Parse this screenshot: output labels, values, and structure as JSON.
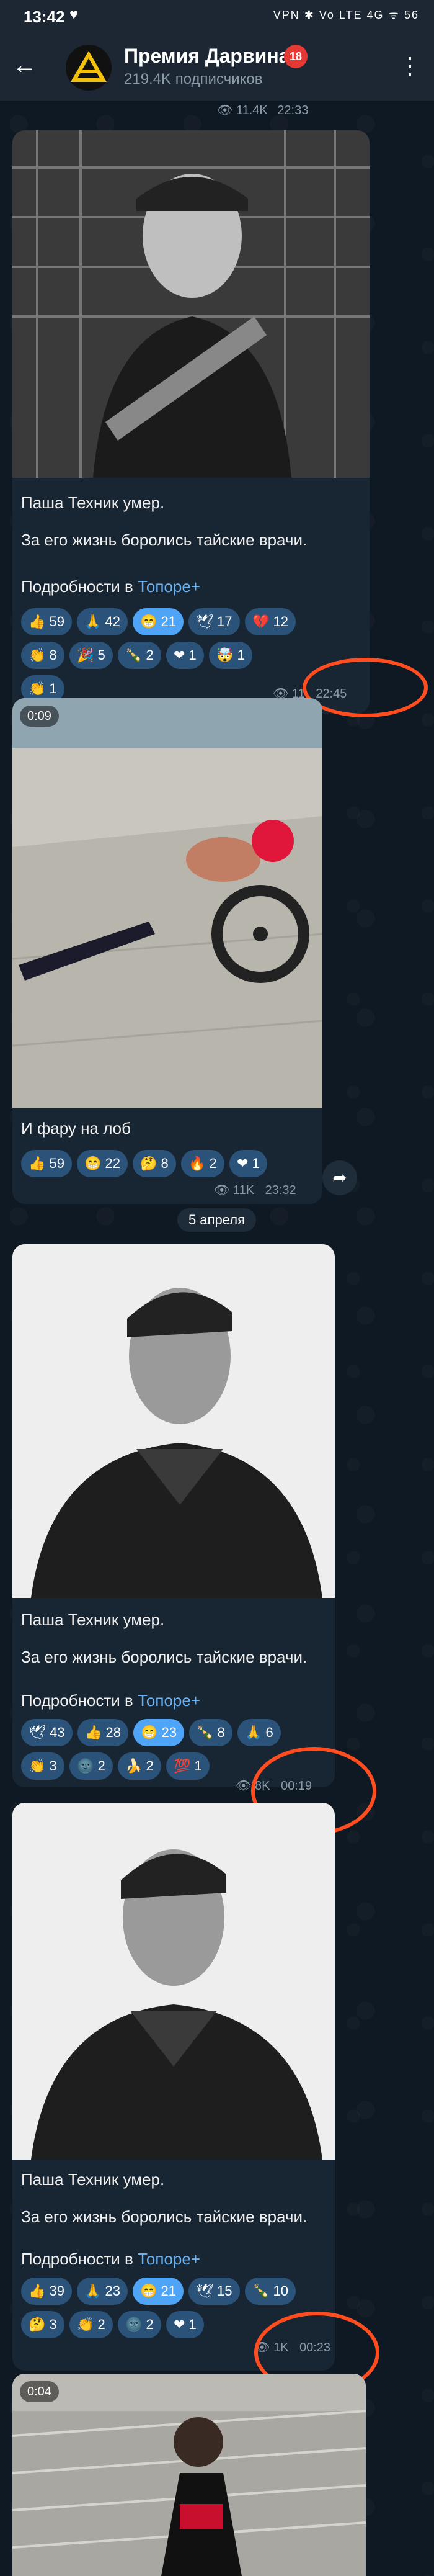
{
  "status_bar": {
    "time": "13:42",
    "indicators": "VPN ✱ Vo LTE 4G ᯤ 56"
  },
  "header": {
    "title": "Премия Дарвина",
    "age_badge": "18",
    "subscribers": "219.4K подписчиков"
  },
  "messages": [
    {
      "id": "msg-top",
      "views": "11.4K",
      "time": "22:33"
    },
    {
      "id": "msg-1",
      "text_line1": "Паша Техник умер.",
      "text_line2": "За его жизнь боролись тайские врачи.",
      "details_prefix": "Подробности в ",
      "details_link": "Топоре+",
      "reactions": [
        {
          "emoji": "👍",
          "count": "59"
        },
        {
          "emoji": "🙏",
          "count": "42"
        },
        {
          "emoji": "😁",
          "count": "21",
          "mine": true
        },
        {
          "emoji": "🕊",
          "count": "17"
        },
        {
          "emoji": "💔",
          "count": "12"
        },
        {
          "emoji": "👏",
          "count": "8"
        },
        {
          "emoji": "🎉",
          "count": "5"
        },
        {
          "emoji": "🍾",
          "count": "2"
        },
        {
          "emoji": "❤",
          "count": "1"
        },
        {
          "emoji": "🤯",
          "count": "1"
        },
        {
          "emoji": "👏",
          "count": "1"
        }
      ],
      "views": "11",
      "time": "22:45"
    },
    {
      "id": "msg-2",
      "duration": "0:09",
      "text": "И фару на лоб",
      "reactions": [
        {
          "emoji": "👍",
          "count": "59"
        },
        {
          "emoji": "😁",
          "count": "22"
        },
        {
          "emoji": "🤔",
          "count": "8"
        },
        {
          "emoji": "🔥",
          "count": "2"
        },
        {
          "emoji": "❤",
          "count": "1"
        }
      ],
      "views": "11K",
      "time": "23:32"
    },
    {
      "id": "msg-3",
      "text_line1": "Паша Техник умер.",
      "text_line2": "За его жизнь боролись тайские врачи.",
      "details_prefix": "Подробности в ",
      "details_link": "Топоре+",
      "reactions": [
        {
          "emoji": "🕊",
          "count": "43"
        },
        {
          "emoji": "👍",
          "count": "28"
        },
        {
          "emoji": "😁",
          "count": "23",
          "mine": true
        },
        {
          "emoji": "🍾",
          "count": "8"
        },
        {
          "emoji": "🙏",
          "count": "6"
        },
        {
          "emoji": "👏",
          "count": "3"
        },
        {
          "emoji": "🌚",
          "count": "2"
        },
        {
          "emoji": "🍌",
          "count": "2"
        },
        {
          "emoji": "💯",
          "count": "1"
        }
      ],
      "views": "8K",
      "time": "00:19"
    },
    {
      "id": "msg-4",
      "text_line1": "Паша Техник умер.",
      "text_line2": "За его жизнь боролись тайские врачи.",
      "details_prefix": "Подробности в ",
      "details_link": "Топоре+",
      "reactions": [
        {
          "emoji": "👍",
          "count": "39"
        },
        {
          "emoji": "🙏",
          "count": "23"
        },
        {
          "emoji": "😁",
          "count": "21",
          "mine": true
        },
        {
          "emoji": "🕊",
          "count": "15"
        },
        {
          "emoji": "🍾",
          "count": "10"
        },
        {
          "emoji": "🤔",
          "count": "3"
        },
        {
          "emoji": "👏",
          "count": "2"
        },
        {
          "emoji": "🌚",
          "count": "2"
        },
        {
          "emoji": "❤",
          "count": "1"
        }
      ],
      "views": "1K",
      "time": "00:23"
    },
    {
      "id": "msg-5",
      "duration": "0:04"
    }
  ],
  "date_divider": "5 апреля",
  "colors": {
    "bubble": "#182533",
    "reaction": "#2b5278",
    "reaction_mine": "#4ea4f6",
    "link": "#6ab3f3",
    "highlight_circle": "#ff4d1f"
  }
}
